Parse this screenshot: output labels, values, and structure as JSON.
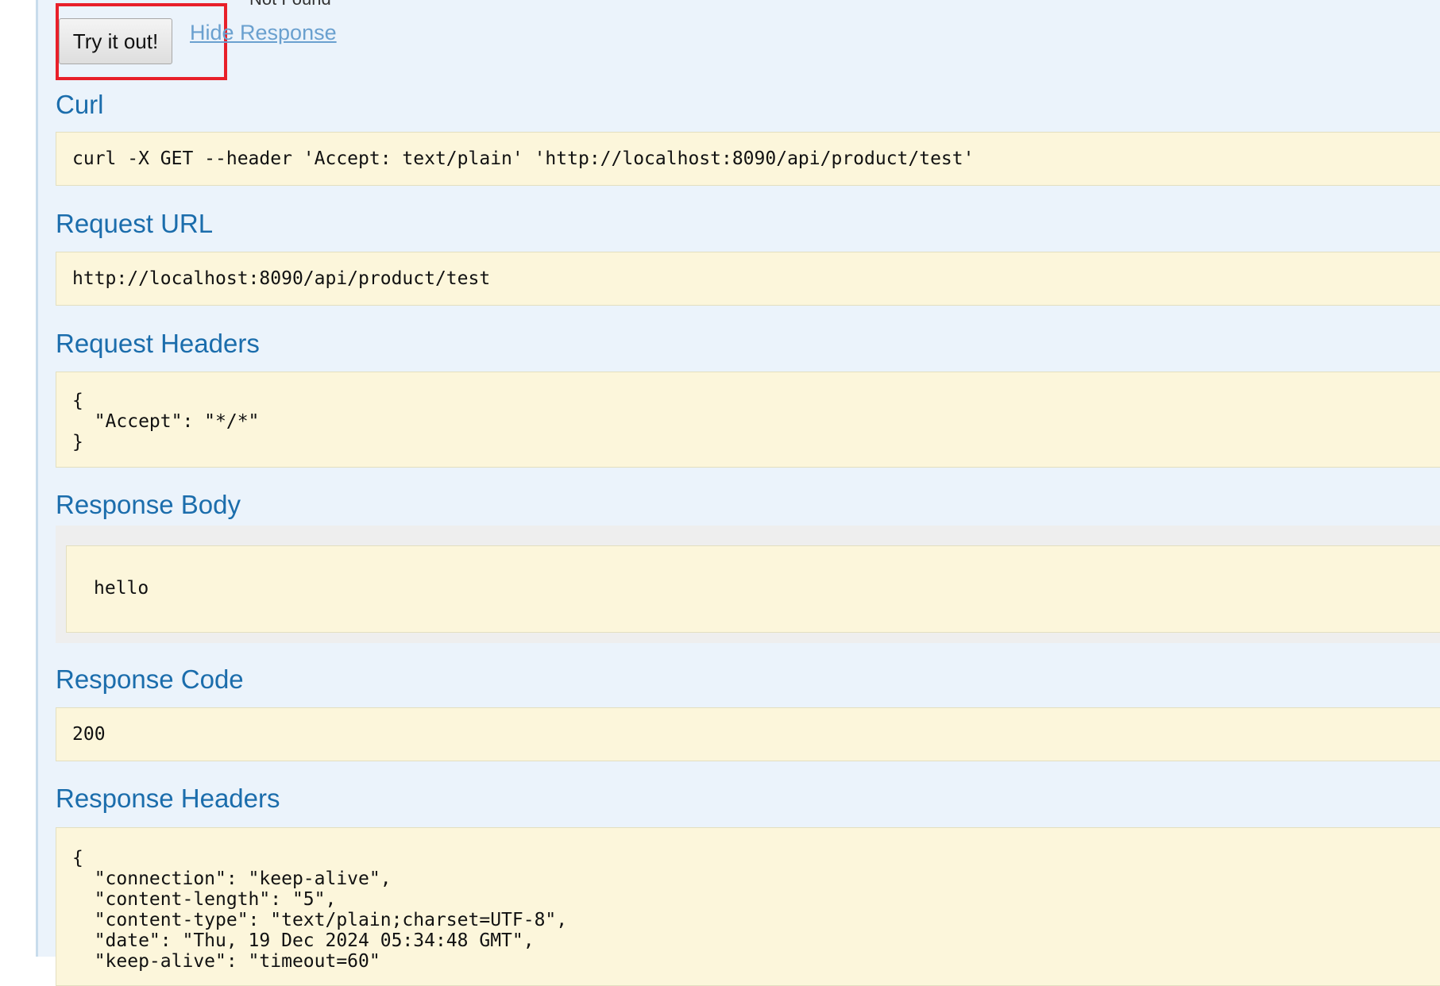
{
  "top": {
    "cutoff_text": "Not Found",
    "try_button_label": "Try it out!",
    "hide_response_label": "Hide Response"
  },
  "curl": {
    "title": "Curl",
    "command": "curl -X GET --header 'Accept: text/plain' 'http://localhost:8090/api/product/test'"
  },
  "request_url": {
    "title": "Request URL",
    "value": "http://localhost:8090/api/product/test"
  },
  "request_headers": {
    "title": "Request Headers",
    "value": "{\n  \"Accept\": \"*/*\"\n}"
  },
  "response_body": {
    "title": "Response Body",
    "value": "hello"
  },
  "response_code": {
    "title": "Response Code",
    "value": "200"
  },
  "response_headers": {
    "title": "Response Headers",
    "value": "{\n  \"connection\": \"keep-alive\",\n  \"content-length\": \"5\",\n  \"content-type\": \"text/plain;charset=UTF-8\",\n  \"date\": \"Thu, 19 Dec 2024 05:34:48 GMT\",\n  \"keep-alive\": \"timeout=60\""
  },
  "colors": {
    "panel_background": "#ebf3fb",
    "section_title": "#1b6dac",
    "code_background": "#fcf6db",
    "link": "#6aa0cf",
    "highlight": "#e8202a"
  }
}
